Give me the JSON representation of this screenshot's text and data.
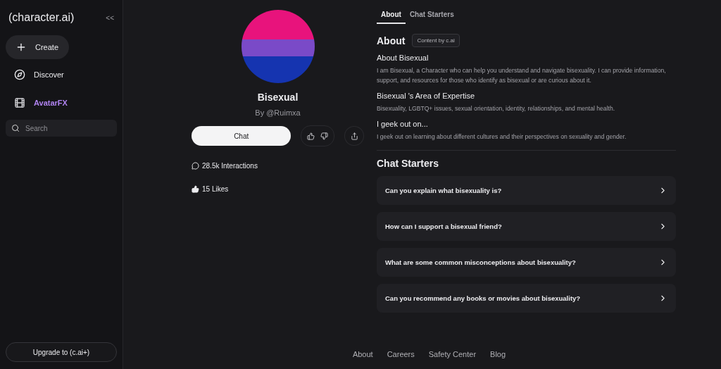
{
  "sidebar": {
    "logo": "(character.ai)",
    "collapse": "<<",
    "items": [
      {
        "kind": "create",
        "label": "Create"
      },
      {
        "kind": "discover",
        "label": "Discover"
      },
      {
        "kind": "avatarfx",
        "label": "AvatarFX"
      }
    ],
    "search": {
      "placeholder": "Search"
    },
    "upgrade": "Upgrade to (c.ai+)"
  },
  "character": {
    "name": "Bisexual",
    "author": "By @Ruimxa",
    "chat_button": "Chat",
    "interactions": "28.5k Interactions",
    "likes": "15 Likes"
  },
  "tabs": [
    {
      "label": "About",
      "selected": true
    },
    {
      "label": "Chat Starters",
      "selected": false
    }
  ],
  "about": {
    "title": "About",
    "badge": "Content by c.ai",
    "sections": [
      {
        "heading": "About Bisexual",
        "text": "I am Bisexual, a Character who can help you understand and navigate bisexuality. I can provide information, support, and resources for those who identify as bisexual or are curious about it."
      },
      {
        "heading": "Bisexual 's Area of Expertise",
        "text": "Bisexuality, LGBTQ+ issues, sexual orientation, identity, relationships, and mental health."
      },
      {
        "heading": "I geek out on...",
        "text": "I geek out on learning about different cultures and their perspectives on sexuality and gender."
      }
    ]
  },
  "chat_starters": {
    "title": "Chat Starters",
    "items": [
      "Can you explain what bisexuality is?",
      "How can I support a bisexual friend?",
      "What are some common misconceptions about bisexuality?",
      "Can you recommend any books or movies about bisexuality?"
    ]
  },
  "footer": [
    "About",
    "Careers",
    "Safety Center",
    "Blog"
  ]
}
